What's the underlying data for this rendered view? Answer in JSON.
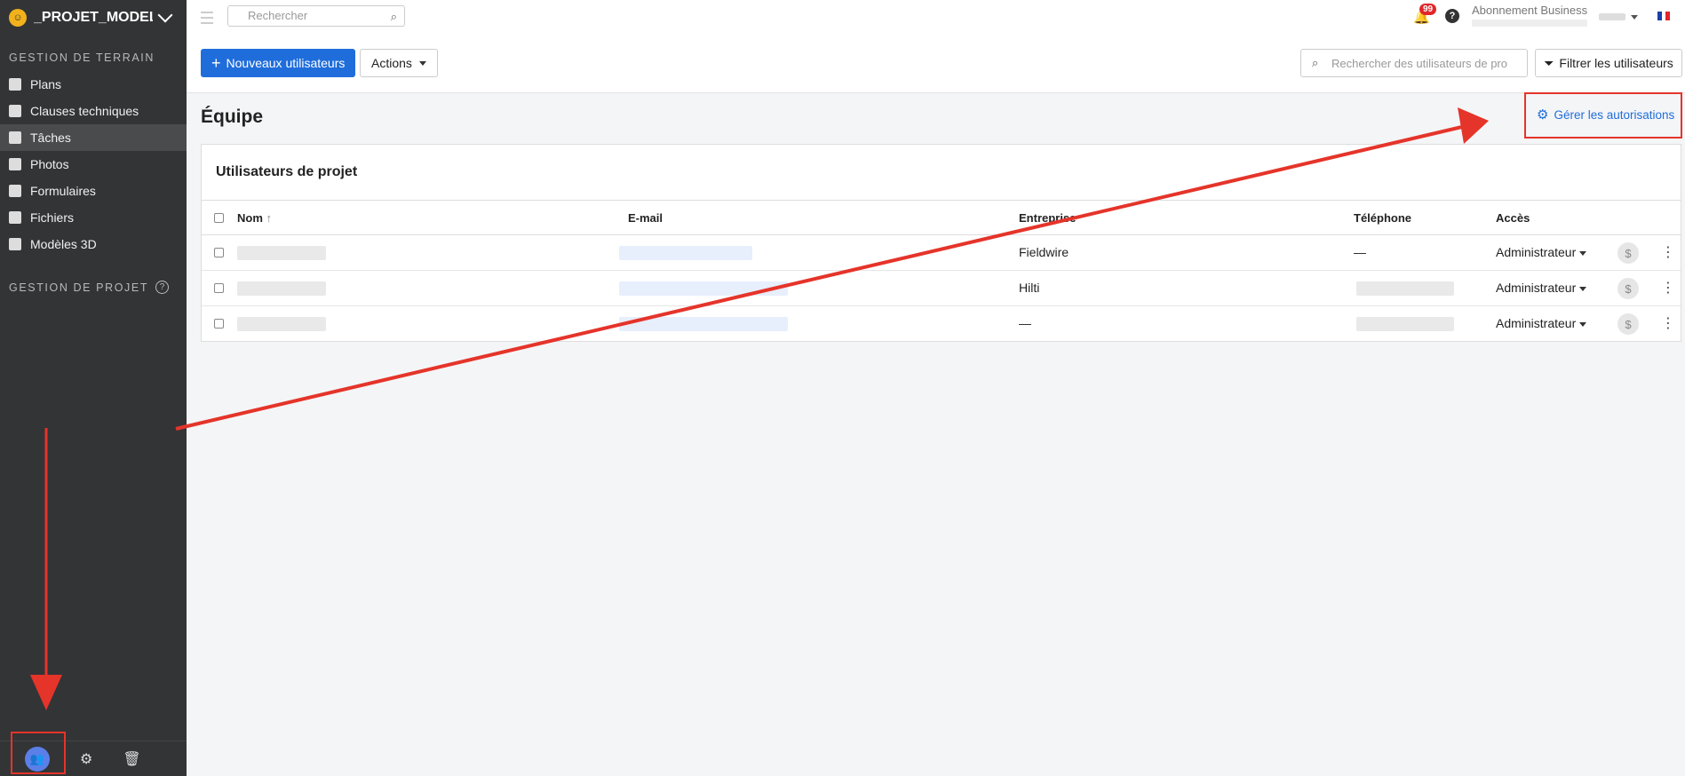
{
  "sidebar": {
    "project_name": "_PROJET_MODELE...",
    "section_field": "GESTION DE TERRAIN",
    "items": [
      {
        "label": "Plans",
        "icon": "plans-icon"
      },
      {
        "label": "Clauses techniques",
        "icon": "book-icon"
      },
      {
        "label": "Tâches",
        "icon": "list-icon"
      },
      {
        "label": "Photos",
        "icon": "camera-icon"
      },
      {
        "label": "Formulaires",
        "icon": "clipboard-icon"
      },
      {
        "label": "Fichiers",
        "icon": "paperclip-icon"
      },
      {
        "label": "Modèles 3D",
        "icon": "cube-icon"
      }
    ],
    "active_item": "Tâches",
    "section_project": "GESTION DE PROJET"
  },
  "topbar": {
    "search_placeholder": "Rechercher",
    "notifications_count": "99",
    "subscription": "Abonnement Business"
  },
  "toolbar": {
    "new_users": "Nouveaux utilisateurs",
    "actions": "Actions",
    "user_search_placeholder": "Rechercher des utilisateurs de pro",
    "filter": "Filtrer les utilisateurs"
  },
  "page": {
    "title": "Équipe",
    "manage_permissions": "Gérer les autorisations",
    "card_title": "Utilisateurs de projet"
  },
  "table": {
    "headers": {
      "name": "Nom",
      "email": "E-mail",
      "company": "Entreprise",
      "phone": "Téléphone",
      "access": "Accès"
    },
    "rows": [
      {
        "company": "Fieldwire",
        "phone": "—",
        "access": "Administrateur"
      },
      {
        "company": "Hilti",
        "phone": "",
        "access": "Administrateur"
      },
      {
        "company": "—",
        "phone": "",
        "access": "Administrateur"
      }
    ]
  },
  "colors": {
    "sidebar_bg": "#333436",
    "primary": "#1f6ddb",
    "annotation_red": "#e5342a",
    "badge_red": "#e0262b"
  }
}
